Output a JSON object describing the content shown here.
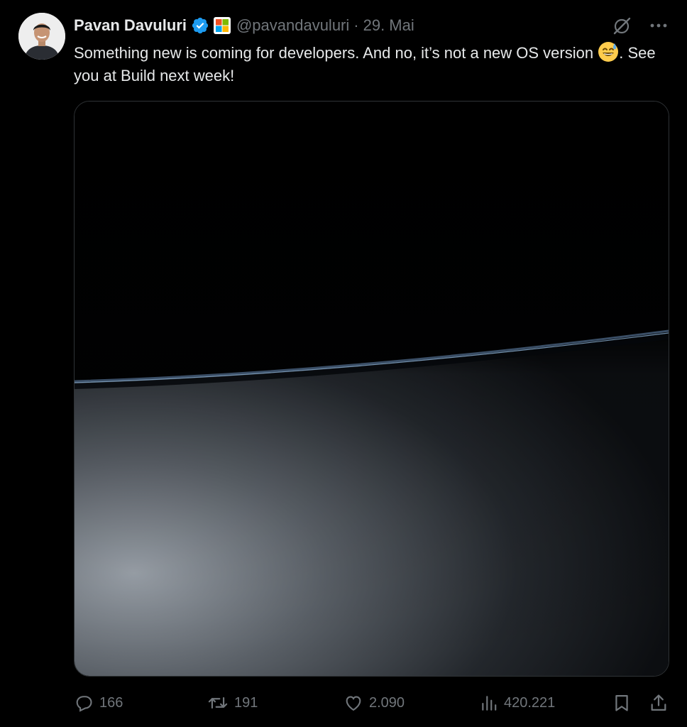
{
  "author": {
    "display_name": "Pavan Davuluri",
    "handle": "@pavandavuluri",
    "separator": "·",
    "date": "29. Mai"
  },
  "post": {
    "text_part1": "Something new is coming for developers. And no, it’s not a new OS version ",
    "emoji": "grinning-face-with-sweat",
    "text_part2": ". See you at Build next week!"
  },
  "metrics": {
    "replies": "166",
    "reposts": "191",
    "likes": "2.090",
    "views": "420.221"
  },
  "icons": {
    "verified": "verified-badge-icon",
    "affiliation": "microsoft-logo-icon",
    "grok": "grok-icon",
    "more": "more-options-icon",
    "reply": "reply-icon",
    "repost": "repost-icon",
    "like": "heart-icon",
    "views": "views-chart-icon",
    "bookmark": "bookmark-icon",
    "share": "share-icon"
  },
  "colors": {
    "background": "#000000",
    "text_primary": "#e7e9ea",
    "text_secondary": "#71767b",
    "verified_blue": "#1d9bf0",
    "border": "#2f3336"
  }
}
